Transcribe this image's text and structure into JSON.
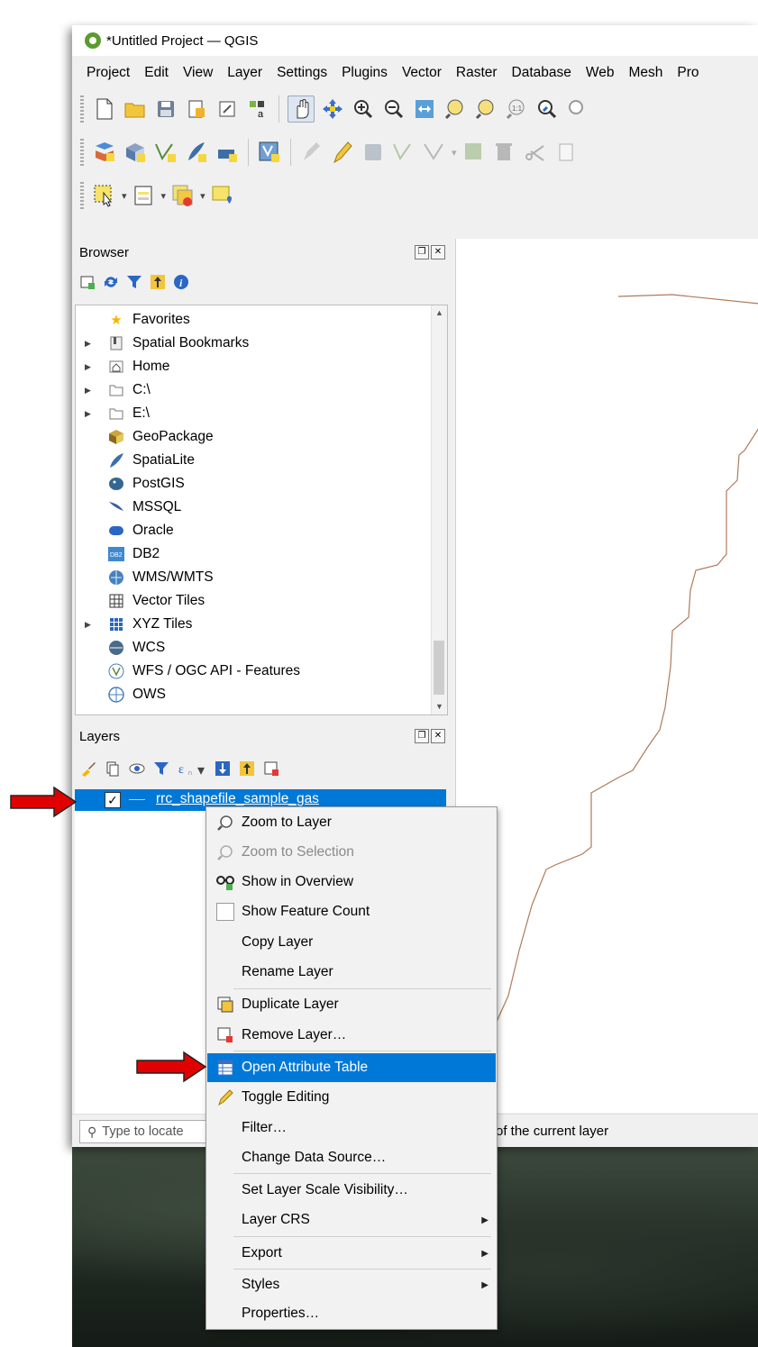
{
  "window": {
    "title": "*Untitled Project — QGIS"
  },
  "menubar": [
    "Project",
    "Edit",
    "View",
    "Layer",
    "Settings",
    "Plugins",
    "Vector",
    "Raster",
    "Database",
    "Web",
    "Mesh",
    "Pro"
  ],
  "toolbars": {
    "navigation_icons": [
      "new-project-icon",
      "open-project-icon",
      "save-project-icon",
      "new-print-layout-icon",
      "layout-manager-icon",
      "style-manager-icon",
      "pan-icon",
      "pan-to-selection-icon",
      "zoom-in-icon",
      "zoom-out-icon",
      "zoom-full-icon",
      "zoom-to-selection-icon",
      "zoom-to-layer-icon",
      "zoom-native-icon",
      "zoom-last-icon"
    ],
    "data_icons": [
      "add-layer-icon",
      "add-geopackage-icon",
      "new-shapefile-icon",
      "digitize-icon",
      "new-virtual-layer-icon",
      "new-temporary-layer-icon",
      "current-edits-icon",
      "toggle-editing-icon",
      "save-edits-icon",
      "add-feature-icon",
      "vertex-tool-icon",
      "modify-attributes-icon",
      "delete-selected-icon",
      "cut-features-icon",
      "copy-features-icon"
    ],
    "selection_icons": [
      "select-features-icon",
      "select-by-value-icon",
      "deselect-icon",
      "select-location-icon"
    ]
  },
  "browser_panel": {
    "title": "Browser",
    "tools": [
      "add-selected-layers-icon",
      "refresh-icon",
      "filter-icon",
      "collapse-all-icon",
      "info-icon"
    ],
    "items": [
      {
        "label": "Favorites",
        "icon": "star-icon",
        "expandable": false
      },
      {
        "label": "Spatial Bookmarks",
        "icon": "bookmark-icon",
        "expandable": true
      },
      {
        "label": "Home",
        "icon": "home-folder-icon",
        "expandable": true
      },
      {
        "label": "C:\\",
        "icon": "drive-icon",
        "expandable": true
      },
      {
        "label": "E:\\",
        "icon": "drive-icon",
        "expandable": true
      },
      {
        "label": "GeoPackage",
        "icon": "geopackage-icon",
        "expandable": false
      },
      {
        "label": "SpatiaLite",
        "icon": "spatialite-icon",
        "expandable": false
      },
      {
        "label": "PostGIS",
        "icon": "postgis-icon",
        "expandable": false
      },
      {
        "label": "MSSQL",
        "icon": "mssql-icon",
        "expandable": false
      },
      {
        "label": "Oracle",
        "icon": "oracle-icon",
        "expandable": false
      },
      {
        "label": "DB2",
        "icon": "db2-icon",
        "expandable": false
      },
      {
        "label": "WMS/WMTS",
        "icon": "wms-icon",
        "expandable": false
      },
      {
        "label": "Vector Tiles",
        "icon": "vector-tiles-icon",
        "expandable": false
      },
      {
        "label": "XYZ Tiles",
        "icon": "xyz-tiles-icon",
        "expandable": true
      },
      {
        "label": "WCS",
        "icon": "wcs-icon",
        "expandable": false
      },
      {
        "label": "WFS / OGC API - Features",
        "icon": "wfs-icon",
        "expandable": false
      },
      {
        "label": "OWS",
        "icon": "ows-icon",
        "expandable": false
      }
    ]
  },
  "layers_panel": {
    "title": "Layers",
    "tools": [
      "style-layer-icon",
      "add-group-icon",
      "visibility-icon",
      "filter-legend-icon",
      "filter-expression-icon",
      "expand-all-icon",
      "collapse-all-icon",
      "remove-layer-icon"
    ],
    "layer": {
      "name": "rrc_shapefile_sample_gas",
      "checked": "✓"
    }
  },
  "context_menu": {
    "items": [
      {
        "label": "Zoom to Layer",
        "icon": "zoom-layer-icon",
        "disabled": false
      },
      {
        "label": "Zoom to Selection",
        "icon": "zoom-selection-icon",
        "disabled": true
      },
      {
        "label": "Show in Overview",
        "icon": "overview-icon",
        "disabled": false
      },
      {
        "label": "Show Feature Count",
        "icon": "checkbox",
        "disabled": false
      },
      {
        "label": "Copy Layer",
        "icon": "",
        "disabled": false
      },
      {
        "label": "Rename Layer",
        "icon": "",
        "disabled": false
      },
      {
        "label": "Duplicate Layer",
        "icon": "duplicate-icon",
        "disabled": false
      },
      {
        "label": "Remove Layer…",
        "icon": "remove-icon",
        "disabled": false
      },
      {
        "label": "Open Attribute Table",
        "icon": "table-icon",
        "disabled": false,
        "highlighted": true
      },
      {
        "label": "Toggle Editing",
        "icon": "pencil-icon",
        "disabled": false
      },
      {
        "label": "Filter…",
        "icon": "",
        "disabled": false
      },
      {
        "label": "Change Data Source…",
        "icon": "",
        "disabled": false
      },
      {
        "label": "Set Layer Scale Visibility…",
        "icon": "",
        "disabled": false
      },
      {
        "label": "Layer CRS",
        "icon": "",
        "disabled": false,
        "submenu": true
      },
      {
        "label": "Export",
        "icon": "",
        "disabled": false,
        "submenu": true
      },
      {
        "label": "Styles",
        "icon": "",
        "disabled": false,
        "submenu": true
      },
      {
        "label": "Properties…",
        "icon": "",
        "disabled": false
      }
    ]
  },
  "statusbar": {
    "locator_placeholder": "Type to locate",
    "message": "of the current layer"
  },
  "colors": {
    "highlight": "#0078d7",
    "map_line": "#b07a5a",
    "annotation_arrow": "#e00000"
  }
}
